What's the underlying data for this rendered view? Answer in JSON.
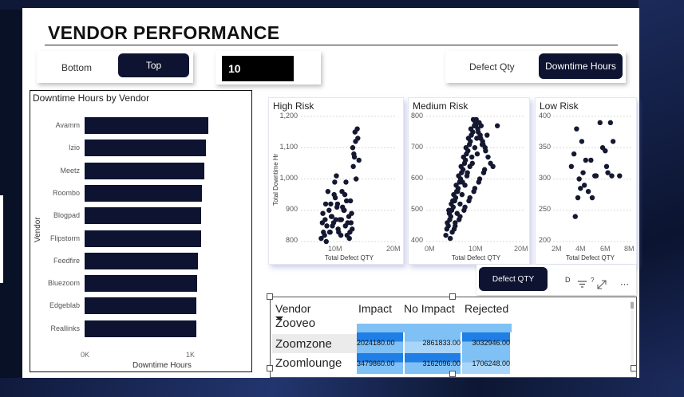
{
  "header": {
    "title": "VENDOR PERFORMANCE"
  },
  "toggle_rank": {
    "bottom_label": "Bottom",
    "top_label": "Top"
  },
  "top_n": {
    "value": "10"
  },
  "toggle_metric": {
    "defect_label": "Defect Qty",
    "downtime_label": "Downtime Hours"
  },
  "bar_chart": {
    "title": "Downtime Hours by Vendor",
    "ylabel": "Vendor",
    "xlabel": "Downtime Hours",
    "xticks": [
      "0K",
      "1K"
    ],
    "chart_data": {
      "type": "bar",
      "orientation": "horizontal",
      "categories": [
        "Avamm",
        "Izio",
        "Meetz",
        "Roombo",
        "Blogpad",
        "Flipstorm",
        "Feedfire",
        "Bluezoom",
        "Edgeblab",
        "Reallinks"
      ],
      "values": [
        1150,
        1125,
        1110,
        1090,
        1085,
        1080,
        1050,
        1045,
        1040,
        1035
      ],
      "xlim": [
        0,
        1300
      ],
      "xlabel": "Downtime Hours",
      "ylabel": "Vendor"
    }
  },
  "scatter_high": {
    "title": "High Risk",
    "ylabel": "Total Downtime Hr",
    "xlabel": "Total Defect QTY",
    "yticks": [
      "1,200",
      "1,100",
      "1,000",
      "900",
      "800"
    ],
    "xticks": [
      "10M",
      "20M"
    ],
    "chart_data": {
      "type": "scatter",
      "xlim": [
        4000000,
        21000000
      ],
      "ylim": [
        800,
        1200
      ],
      "x": [
        8000000,
        8300000,
        8600000,
        9000000,
        9300000,
        9500000,
        9800000,
        10100000,
        10400000,
        10700000,
        11000000,
        11300000,
        11600000,
        11900000,
        12200000,
        12500000,
        12800000,
        13100000,
        13400000,
        13700000,
        14000000,
        14300000,
        7600000,
        7900000,
        8800000,
        9100000,
        9600000,
        10000000,
        10500000,
        10900000,
        11400000,
        11800000,
        12300000,
        12700000,
        13000000,
        13300000,
        13600000,
        8200000,
        8500000,
        9400000,
        9900000,
        10300000,
        10600000,
        11200000,
        11700000,
        12100000,
        12600000,
        13200000,
        7800000,
        8400000,
        9200000,
        10200000,
        11100000,
        12000000,
        12900000,
        13500000,
        14100000,
        13800000
      ],
      "y": [
        830,
        870,
        850,
        900,
        920,
        880,
        860,
        940,
        910,
        830,
        870,
        960,
        900,
        850,
        820,
        880,
        930,
        840,
        1080,
        1120,
        1160,
        1060,
        810,
        890,
        960,
        830,
        850,
        990,
        920,
        870,
        910,
        950,
        860,
        830,
        890,
        1040,
        1150,
        820,
        800,
        880,
        950,
        1010,
        840,
        870,
        900,
        930,
        810,
        1100,
        860,
        920,
        830,
        870,
        820,
        990,
        860,
        1070,
        1130,
        1000
      ]
    }
  },
  "scatter_medium": {
    "title": "Medium Risk",
    "xlabel": "Total Defect QTY",
    "yticks": [
      "800",
      "700",
      "600",
      "500",
      "400"
    ],
    "xticks": [
      "0M",
      "10M",
      "20M"
    ],
    "chart_data": {
      "type": "scatter",
      "xlim": [
        0,
        20000000
      ],
      "ylim": [
        400,
        800
      ],
      "x": [
        4000000,
        4500000,
        5000000,
        5500000,
        6000000,
        6500000,
        7000000,
        7500000,
        8000000,
        8500000,
        9000000,
        9500000,
        10000000,
        10500000,
        11000000,
        11500000,
        12000000,
        4200000,
        4800000,
        5200000,
        5800000,
        6200000,
        6800000,
        7200000,
        7800000,
        8200000,
        8800000,
        9200000,
        9800000,
        10200000,
        10800000,
        11200000,
        4300000,
        4700000,
        5100000,
        5600000,
        6100000,
        6600000,
        7100000,
        7600000,
        8100000,
        8600000,
        9100000,
        9600000,
        10100000,
        10600000,
        11100000,
        11600000,
        12100000,
        12600000,
        13100000,
        13600000,
        14500000,
        5300000,
        5900000,
        6300000,
        6900000,
        7300000,
        7900000,
        8300000,
        8900000,
        9300000,
        9900000,
        10300000,
        4600000,
        5400000,
        6400000,
        7400000,
        8400000,
        9400000,
        10400000,
        11400000,
        12400000,
        5700000,
        6700000,
        7700000,
        8700000,
        9700000,
        10700000,
        11700000,
        4900000,
        5900000,
        6900000,
        7900000,
        8900000,
        9900000,
        10900000,
        11900000
      ],
      "y": [
        420,
        450,
        480,
        510,
        540,
        570,
        600,
        630,
        660,
        690,
        720,
        750,
        780,
        760,
        740,
        720,
        700,
        440,
        470,
        500,
        530,
        560,
        590,
        620,
        650,
        680,
        710,
        740,
        770,
        790,
        780,
        770,
        460,
        490,
        520,
        550,
        580,
        610,
        640,
        670,
        700,
        730,
        760,
        790,
        770,
        750,
        730,
        710,
        690,
        670,
        650,
        640,
        770,
        430,
        460,
        490,
        520,
        550,
        580,
        610,
        640,
        670,
        700,
        730,
        500,
        530,
        560,
        590,
        620,
        650,
        680,
        710,
        740,
        440,
        470,
        500,
        530,
        560,
        590,
        620,
        410,
        450,
        480,
        510,
        540,
        570,
        600,
        630
      ]
    }
  },
  "scatter_low": {
    "title": "Low Risk",
    "xlabel": "Total Defect QTY",
    "yticks": [
      "400",
      "350",
      "300",
      "250",
      "200"
    ],
    "xticks": [
      "2M",
      "4M",
      "6M",
      "8M"
    ],
    "chart_data": {
      "type": "scatter",
      "xlim": [
        2000000,
        8000000
      ],
      "ylim": [
        200,
        400
      ],
      "x": [
        3400000,
        3600000,
        3800000,
        4000000,
        4200000,
        4500000,
        4700000,
        5000000,
        5200000,
        5600000,
        5800000,
        6000000,
        6200000,
        6400000,
        6600000,
        7100000,
        3700000,
        4100000,
        4400000,
        4900000,
        5300000,
        6100000,
        6500000,
        3900000,
        4300000
      ],
      "y": [
        320,
        340,
        380,
        300,
        360,
        330,
        280,
        270,
        305,
        390,
        350,
        345,
        310,
        390,
        360,
        305,
        240,
        285,
        290,
        330,
        305,
        320,
        305,
        270,
        310
      ]
    }
  },
  "slicer_popup": {
    "defect_label": "Defect QTY",
    "partial_label": "D"
  },
  "table": {
    "headers": [
      "Vendor",
      "Impact",
      "No Impact",
      "Rejected"
    ],
    "rows": [
      {
        "vendor": "Zooveo",
        "impact": "",
        "no_impact": "",
        "rejected": ""
      },
      {
        "vendor": "Zoomzone",
        "impact": "2024180.00",
        "no_impact": "2861833.00",
        "rejected": "3032946.00"
      },
      {
        "vendor": "Zoomlounge",
        "impact": "3479860.00",
        "no_impact": "3162096.00",
        "rejected": "1706248.00"
      }
    ]
  },
  "icons": [
    "filter-icon",
    "expand-icon",
    "more-options-icon",
    "sort-desc-icon"
  ],
  "colors": {
    "bar": "#0d1330",
    "dot": "#141830",
    "cell_dark": "#1f7fe6",
    "cell_light": "#7fc0f5"
  }
}
